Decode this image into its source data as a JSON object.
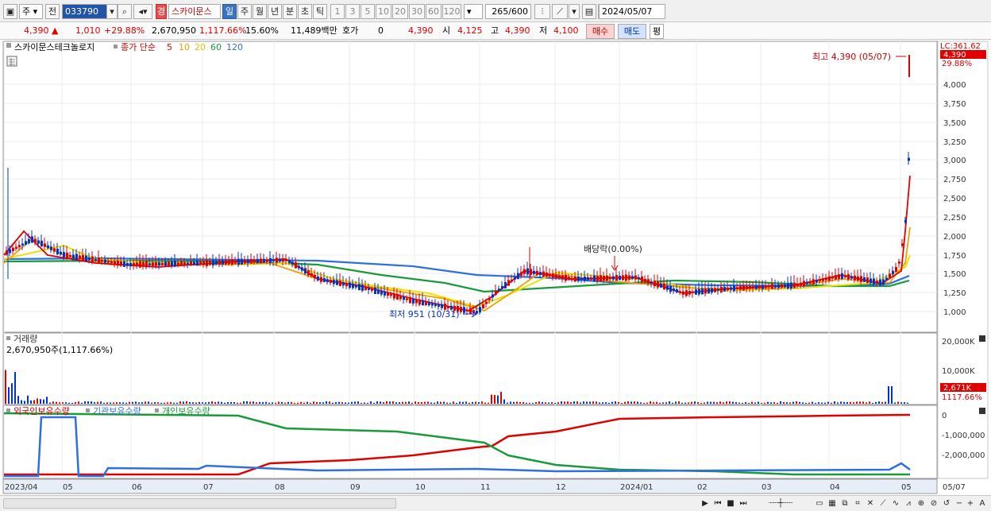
{
  "toolbar": {
    "market": "주",
    "jeon": "전",
    "code": "033790",
    "stock_name": "스카이문스",
    "stock_prefix": "경",
    "periods": [
      "일",
      "주",
      "월",
      "년",
      "분",
      "초",
      "틱"
    ],
    "active_period": "일",
    "intervals": [
      "1",
      "3",
      "5",
      "10",
      "20",
      "30",
      "60",
      "120"
    ],
    "count": "265",
    "count_total": "/600",
    "date": "2024/05/07"
  },
  "quote": {
    "price": "4,390",
    "change": "1,010",
    "change_pct": "+29.88%",
    "volume": "2,670,950",
    "volume_pct": "1,117.66%",
    "turnover": "15.60%",
    "amount": "11,489백만",
    "hoga_label": "호가",
    "hoga_value": "0",
    "hoga_price": "4,390",
    "open_label": "시",
    "open": "4,125",
    "high_label": "고",
    "high": "4,390",
    "low_label": "저",
    "low": "4,100",
    "buy_label": "매수",
    "sell_label": "매도",
    "eval_label": "평"
  },
  "legend": {
    "name": "스카이문스테크놀로지",
    "ma_label": "종가 단순",
    "ma_periods": [
      "5",
      "10",
      "20",
      "60",
      "120"
    ],
    "ma_colors": [
      "#e00000",
      "#f0a000",
      "#f0e000",
      "#1a9a3a",
      "#2f6fe0"
    ]
  },
  "annotations": {
    "lc_label": "LC:361.62",
    "current_tag": "4,390",
    "pct_tag": "29.88%",
    "high_label": "최고 4,390 (05/07)",
    "low_label": "최저 951 (10/31)",
    "dividend_label": "배당락(0.00%)"
  },
  "price_axis": [
    "4,000",
    "3,750",
    "3,500",
    "3,250",
    "3,000",
    "2,750",
    "2,500",
    "2,250",
    "2,000",
    "1,750",
    "1,500",
    "1,250",
    "1,000"
  ],
  "volume_panel": {
    "title": "거래량",
    "current": "2,670,950주(1,117.66%)",
    "axis": [
      "20,000K",
      "10,000K"
    ],
    "tag": "2,671K",
    "pct_tag": "1117.66%"
  },
  "holdings_panel": {
    "series": [
      "외국인보유수량",
      "기관보유수량",
      "개인보유수량"
    ],
    "colors": [
      "#e00000",
      "#2f6fe0",
      "#1a9a3a"
    ],
    "axis": [
      "0",
      "-1,000,000",
      "-2,000,000"
    ]
  },
  "x_axis": [
    "2023/04",
    "05",
    "06",
    "07",
    "08",
    "09",
    "10",
    "11",
    "12",
    "2024/01",
    "02",
    "03",
    "04",
    "05",
    "05/07"
  ]
}
